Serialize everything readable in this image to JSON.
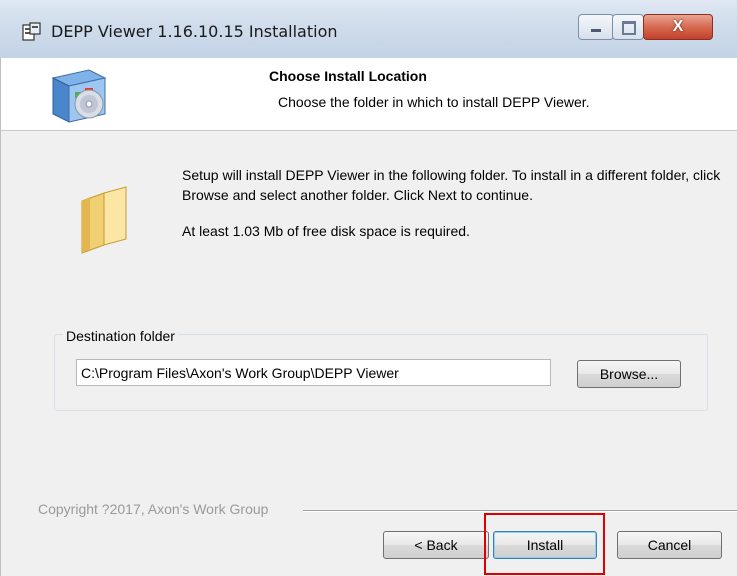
{
  "window": {
    "title": "DEPP Viewer 1.16.10.15 Installation",
    "icons": {
      "app": "installer-icon",
      "minimize": "minimize-icon",
      "maximize": "maximize-icon",
      "close": "close-icon"
    },
    "close_glyph": "X"
  },
  "header": {
    "title": "Choose Install Location",
    "subtitle": "Choose the folder in which to install DEPP Viewer.",
    "icon": "install-cd-box-icon"
  },
  "body": {
    "folder_icon": "folder-icon",
    "description": "Setup will install DEPP Viewer in the following folder. To install in a different folder, click Browse and select another folder. Click Next to continue.",
    "space_required": "At least 1.03 Mb of free disk space is required."
  },
  "destination": {
    "group_label": "Destination folder",
    "path_value": "C:\\Program Files\\Axon's Work Group\\DEPP Viewer",
    "browse_label": "Browse..."
  },
  "footer": {
    "copyright": "Copyright ?2017, Axon's Work Group",
    "back_label": "< Back",
    "install_label": "Install",
    "cancel_label": "Cancel"
  },
  "colors": {
    "highlight": "#e00000",
    "close_button": "#c2412a"
  }
}
